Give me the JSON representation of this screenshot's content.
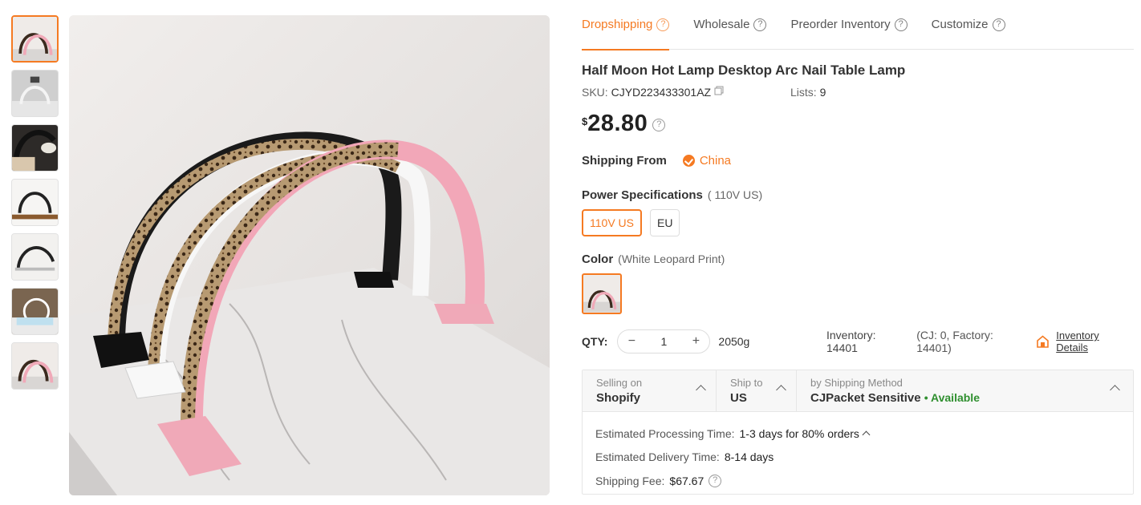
{
  "tabs": [
    {
      "label": "Dropshipping",
      "active": true
    },
    {
      "label": "Wholesale",
      "active": false
    },
    {
      "label": "Preorder Inventory",
      "active": false
    },
    {
      "label": "Customize",
      "active": false
    }
  ],
  "product": {
    "title": "Half Moon Hot Lamp Desktop Arc Nail Table Lamp",
    "sku_label": "SKU:",
    "sku": "CJYD223433301AZ",
    "lists_label": "Lists:",
    "lists": "9",
    "currency": "$",
    "price": "28.80"
  },
  "shipping_from": {
    "label": "Shipping From",
    "value": "China"
  },
  "power": {
    "label": "Power Specifications",
    "selected_text": "( 110V US)",
    "options": [
      {
        "label": "110V US",
        "selected": true
      },
      {
        "label": "EU",
        "selected": false
      }
    ]
  },
  "color": {
    "label": "Color",
    "selected_text": "(White Leopard Print)"
  },
  "qty": {
    "label": "QTY:",
    "value": "1",
    "minus": "−",
    "plus": "+",
    "weight": "2050g"
  },
  "inventory": {
    "text": "Inventory: 14401",
    "breakdown": "(CJ: 0, Factory: 14401)",
    "details_link": "Inventory Details"
  },
  "shipping": {
    "selling_on_caption": "Selling on",
    "selling_on": "Shopify",
    "ship_to_caption": "Ship to",
    "ship_to": "US",
    "method_caption": "by Shipping Method",
    "method": "CJPacket Sensitive",
    "availability": "• Available",
    "processing_label": "Estimated Processing Time:",
    "processing_value": "1-3 days for 80% orders",
    "delivery_label": "Estimated Delivery Time:",
    "delivery_value": "8-14 days",
    "fee_label": "Shipping Fee:",
    "fee_value": "$67.67"
  },
  "colors": {
    "accent": "#f57a22",
    "available": "#2f8f2f"
  },
  "icons": [
    "help-circle-icon",
    "copy-icon",
    "check-circle-icon",
    "warehouse-icon",
    "chevron-up-icon"
  ]
}
